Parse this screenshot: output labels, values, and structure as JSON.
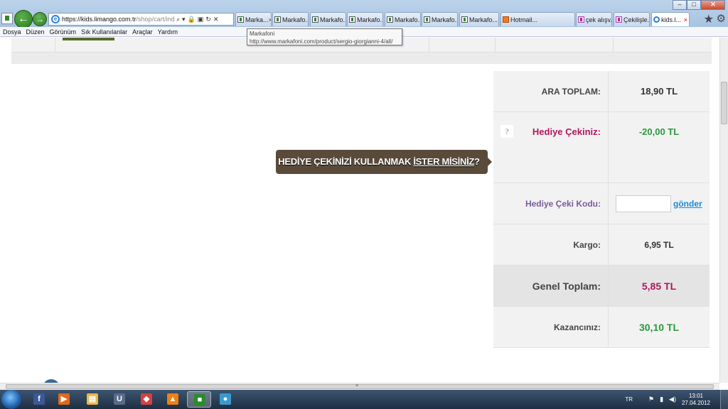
{
  "browser": {
    "url_host": "https://kids.limango.com.tr",
    "url_path": "/shop/cart/indexa",
    "tabs": [
      {
        "label": "Marka...",
        "icon": "site",
        "close": "×",
        "active": false
      },
      {
        "label": "Markafo...",
        "icon": "site",
        "active": false
      },
      {
        "label": "Markafo...",
        "icon": "site",
        "active": false
      },
      {
        "label": "Markafo...",
        "icon": "site",
        "active": false
      },
      {
        "label": "Markafo...",
        "icon": "site",
        "active": false
      },
      {
        "label": "Markafo...",
        "icon": "site",
        "active": false
      },
      {
        "label": "Markafo...",
        "icon": "site",
        "active": false
      },
      {
        "label": "Hotmail...",
        "icon": "hotmail",
        "active": false
      },
      {
        "label": "çek alışv...",
        "icon": "pink",
        "active": false
      },
      {
        "label": "Çekilişle...",
        "icon": "pink",
        "active": false
      },
      {
        "label": "kids.l...",
        "icon": "ie",
        "close": "×",
        "active": true
      }
    ],
    "menu": [
      "Dosya",
      "Düzen",
      "Görünüm",
      "Sık Kullanılanlar",
      "Araçlar",
      "Yardım"
    ],
    "tooltip": {
      "title": "Markafoni",
      "url": "http://www.markafoni.com/product/sergio-giorgianni-4/all/"
    }
  },
  "hint": {
    "text_before": "HEDİYE ÇEKİNİZİ KULLANMAK ",
    "text_underlined": "İSTER MİSİNİZ",
    "text_after": "?"
  },
  "summary": {
    "subtotal_label": "ARA TOPLAM:",
    "subtotal_value": "18,90 TL",
    "gift_help": "?",
    "gift_label": "Hediye Çekiniz:",
    "gift_value": "-20,00 TL",
    "code_label": "Hediye Çeki Kodu:",
    "code_value": "",
    "send_label": "gönder",
    "cargo_label": "Kargo:",
    "cargo_value": "6,95 TL",
    "total_label": "Genel Toplam:",
    "total_value": "5,85 TL",
    "savings_label": "Kazancınız:",
    "savings_value": "30,10 TL"
  },
  "taskbar": {
    "apps": [
      {
        "name": "facebook",
        "glyph": "f",
        "color": "#3b5998"
      },
      {
        "name": "media-player",
        "glyph": "▶",
        "color": "#e06a1a"
      },
      {
        "name": "explorer",
        "glyph": "▤",
        "color": "#e8b84a"
      },
      {
        "name": "app-u",
        "glyph": "U",
        "color": "#5a6a8a"
      },
      {
        "name": "app-card",
        "glyph": "◆",
        "color": "#d64040"
      },
      {
        "name": "vlc",
        "glyph": "▲",
        "color": "#f08010"
      },
      {
        "name": "app-active",
        "glyph": "■",
        "color": "#2d8a2a"
      },
      {
        "name": "messenger",
        "glyph": "●",
        "color": "#3a9ad0"
      }
    ],
    "language": "TR",
    "time": "13:01",
    "date": "27.04.2012"
  }
}
